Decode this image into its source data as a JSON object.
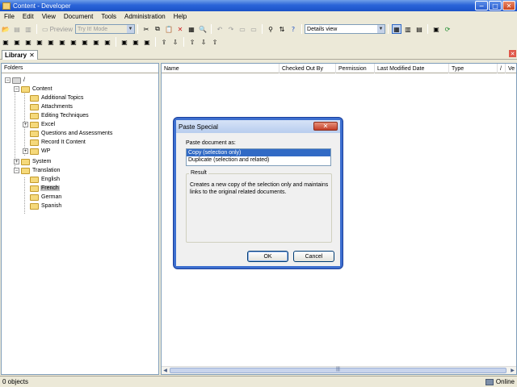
{
  "window": {
    "title": "Content - Developer",
    "minimize": "−",
    "maximize": "□",
    "close": "✕"
  },
  "menu": [
    "File",
    "Edit",
    "View",
    "Document",
    "Tools",
    "Administration",
    "Help"
  ],
  "toolbar": {
    "preview_label": "Preview",
    "mode_value": "Try It! Mode",
    "view_value": "Details view"
  },
  "tabs": {
    "library_label": "Library",
    "library_close": "✕"
  },
  "folders": {
    "header": "Folders",
    "root_label": "/",
    "content_label": "Content",
    "content_children": [
      "Additional Topics",
      "Attachments",
      "Editing Techniques",
      "Excel",
      "Questions and Assessments",
      "Record It Content",
      "WP"
    ],
    "system_label": "System",
    "translation_label": "Translation",
    "translation_children": [
      "English",
      "French",
      "German",
      "Spanish"
    ],
    "selected": "French"
  },
  "list": {
    "columns": [
      "Name",
      "Checked Out By",
      "Permission",
      "Last Modified Date",
      "Type",
      "/",
      "Ve"
    ]
  },
  "dialog": {
    "title": "Paste Special",
    "close": "✕",
    "prompt": "Paste document as:",
    "options": [
      "Copy (selection only)",
      "Duplicate (selection and related)"
    ],
    "selected_option": "Copy (selection only)",
    "result_title": "Result",
    "result_text": "Creates a new copy of the selection only and maintains links to the original related documents.",
    "ok_label": "OK",
    "cancel_label": "Cancel"
  },
  "status": {
    "left": "0 objects",
    "right": "Online"
  },
  "scroll": {
    "grip": "|||"
  }
}
